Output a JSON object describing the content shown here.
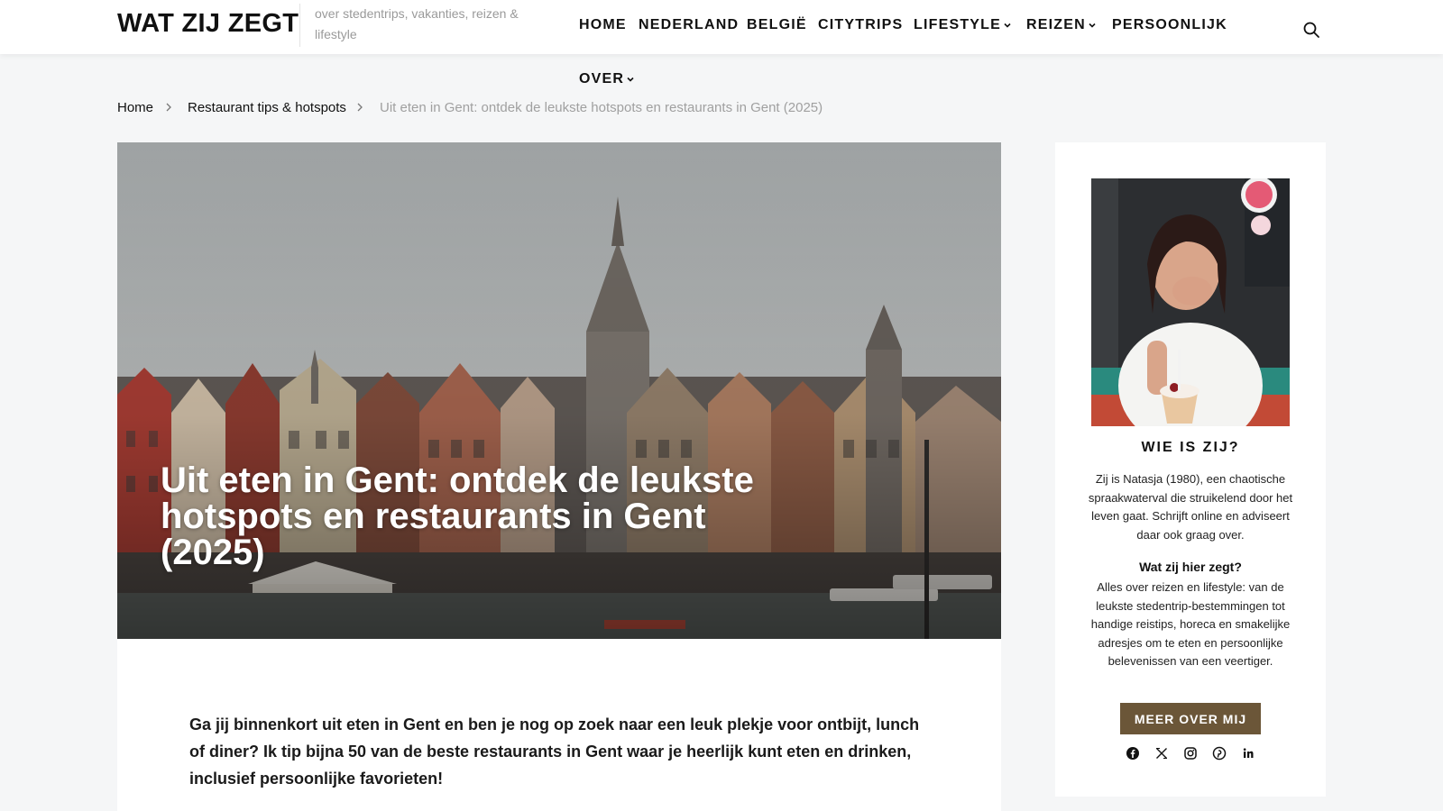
{
  "site": {
    "logo": "WAT ZIJ ZEGT",
    "tagline": "over stedentrips, vakanties, reizen & lifestyle"
  },
  "nav": {
    "items": [
      {
        "label": "HOME",
        "dropdown": false
      },
      {
        "label": "NEDERLAND",
        "dropdown": false
      },
      {
        "label": "BELGIË",
        "dropdown": false
      },
      {
        "label": "CITYTRIPS",
        "dropdown": false
      },
      {
        "label": "LIFESTYLE",
        "dropdown": true
      },
      {
        "label": "REIZEN",
        "dropdown": true
      },
      {
        "label": "PERSOONLIJK",
        "dropdown": false
      },
      {
        "label": "OVER",
        "dropdown": true
      }
    ],
    "search_icon": "search-icon"
  },
  "breadcrumb": {
    "items": [
      "Home",
      "Restaurant tips & hotspots",
      "Uit eten in Gent: ontdek de leukste hotspots en restaurants in Gent (2025)"
    ]
  },
  "hero": {
    "title": "Uit eten in Gent: ontdek de leukste hotspots en restaurants in Gent (2025)"
  },
  "article": {
    "intro": "Ga jij binnenkort uit eten in Gent en ben je nog op zoek naar een leuk plekje voor ontbijt, lunch of diner? Ik tip bijna 50 van de beste restaurants in Gent waar je heerlijk kunt eten en drinken, inclusief persoonlijke favorieten!"
  },
  "sidebar": {
    "heading": "WIE IS ZIJ?",
    "bio": "Zij is Natasja (1980), een chaotische spraakwaterval die struikelend door het leven gaat. Schrijft online en adviseert daar ook graag over.",
    "subheading": "Wat zij hier zegt?",
    "description": "Alles over reizen en lifestyle: van de leukste stedentrip-bestemmingen tot handige reistips, horeca en smakelijke adresjes om te eten en persoonlijke belevenissen van een veertiger.",
    "button_label": "MEER OVER MIJ",
    "social_icons": [
      "facebook-icon",
      "x-icon",
      "instagram-icon",
      "pinterest-icon",
      "linkedin-icon"
    ]
  },
  "colors": {
    "page_bg": "#f5f6f7",
    "button_bg": "#6b5638",
    "breadcrumb_current": "#a0a0a0"
  }
}
